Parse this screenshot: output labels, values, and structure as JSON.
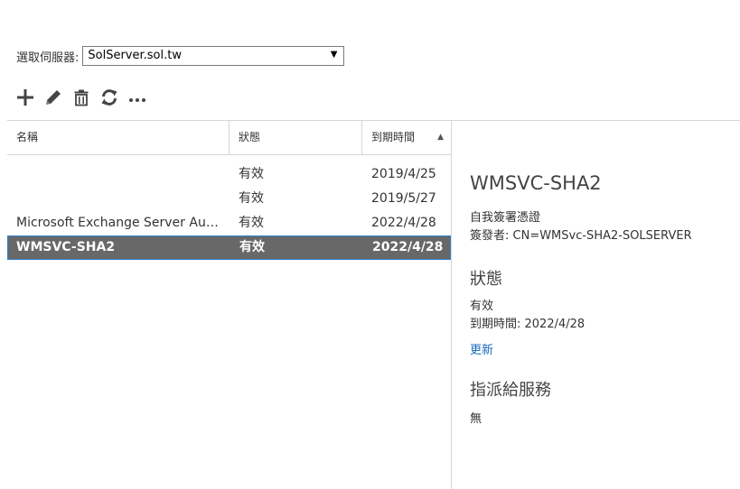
{
  "server": {
    "label": "選取伺服器:",
    "selected": "SolServer.sol.tw"
  },
  "toolbar": [
    {
      "name": "add-icon",
      "tooltip": "新增"
    },
    {
      "name": "edit-icon",
      "tooltip": "編輯"
    },
    {
      "name": "delete-icon",
      "tooltip": "刪除"
    },
    {
      "name": "refresh-icon",
      "tooltip": "重新整理"
    },
    {
      "name": "more-icon",
      "tooltip": "更多選項"
    }
  ],
  "table": {
    "columns": [
      "名稱",
      "狀態",
      "到期時間"
    ],
    "sort_column": "到期時間",
    "sort_direction": "ascending",
    "rows": [
      {
        "name": "",
        "status": "有效",
        "expires": "2019/4/25"
      },
      {
        "name": "",
        "status": "有效",
        "expires": "2019/5/27"
      },
      {
        "name": "Microsoft Exchange Server Auth ...",
        "status": "有效",
        "expires": "2022/4/28"
      },
      {
        "name": "WMSVC-SHA2",
        "status": "有效",
        "expires": "2022/4/28"
      }
    ],
    "selected_index": 3
  },
  "details": {
    "title": "WMSVC-SHA2",
    "type": "自我簽署憑證",
    "issuer": "簽發者: CN=WMSvc-SHA2-SOLSERVER",
    "status_heading": "狀態",
    "status_value": "有效",
    "expiry": "到期時間: 2022/4/28",
    "renew_link": "更新",
    "services_heading": "指派給服務",
    "services_value": "無"
  },
  "colors": {
    "selected_row_bg": "#686868",
    "selected_row_border": "#2f7fd0",
    "link": "#1a6bbf",
    "toolbar_icon": "#444444"
  }
}
